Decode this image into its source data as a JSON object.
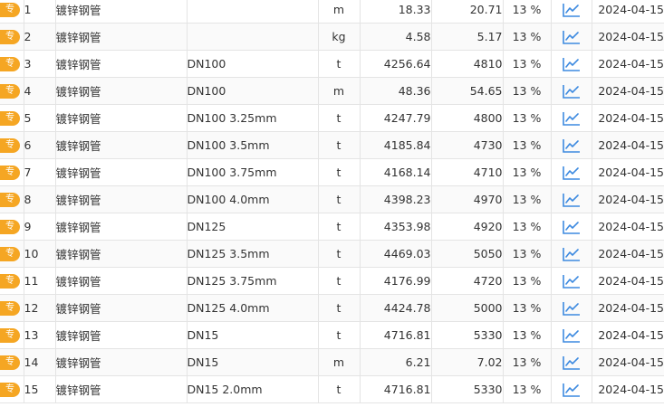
{
  "colors": {
    "badge": "#f5a623",
    "trend_icon": "#3d8ae0",
    "border": "#e4e4e4"
  },
  "row_badge_icon": "special-tag-icon",
  "trend_icon_name": "line-chart-icon",
  "rows": [
    {
      "badge": "专",
      "index": "1",
      "name": "镀锌钢管",
      "spec": "",
      "unit": "m",
      "price": "18.33",
      "price_with_tax": "20.71",
      "tax_rate": "13 %",
      "date": "2024-04-15"
    },
    {
      "badge": "专",
      "index": "2",
      "name": "镀锌钢管",
      "spec": "",
      "unit": "kg",
      "price": "4.58",
      "price_with_tax": "5.17",
      "tax_rate": "13 %",
      "date": "2024-04-15"
    },
    {
      "badge": "专",
      "index": "3",
      "name": "镀锌钢管",
      "spec": "DN100",
      "unit": "t",
      "price": "4256.64",
      "price_with_tax": "4810",
      "tax_rate": "13 %",
      "date": "2024-04-15"
    },
    {
      "badge": "专",
      "index": "4",
      "name": "镀锌钢管",
      "spec": "DN100",
      "unit": "m",
      "price": "48.36",
      "price_with_tax": "54.65",
      "tax_rate": "13 %",
      "date": "2024-04-15"
    },
    {
      "badge": "专",
      "index": "5",
      "name": "镀锌钢管",
      "spec": "DN100  3.25mm",
      "unit": "t",
      "price": "4247.79",
      "price_with_tax": "4800",
      "tax_rate": "13 %",
      "date": "2024-04-15"
    },
    {
      "badge": "专",
      "index": "6",
      "name": "镀锌钢管",
      "spec": "DN100  3.5mm",
      "unit": "t",
      "price": "4185.84",
      "price_with_tax": "4730",
      "tax_rate": "13 %",
      "date": "2024-04-15"
    },
    {
      "badge": "专",
      "index": "7",
      "name": "镀锌钢管",
      "spec": "DN100  3.75mm",
      "unit": "t",
      "price": "4168.14",
      "price_with_tax": "4710",
      "tax_rate": "13 %",
      "date": "2024-04-15"
    },
    {
      "badge": "专",
      "index": "8",
      "name": "镀锌钢管",
      "spec": "DN100  4.0mm",
      "unit": "t",
      "price": "4398.23",
      "price_with_tax": "4970",
      "tax_rate": "13 %",
      "date": "2024-04-15"
    },
    {
      "badge": "专",
      "index": "9",
      "name": "镀锌钢管",
      "spec": "DN125",
      "unit": "t",
      "price": "4353.98",
      "price_with_tax": "4920",
      "tax_rate": "13 %",
      "date": "2024-04-15"
    },
    {
      "badge": "专",
      "index": "10",
      "name": "镀锌钢管",
      "spec": "DN125  3.5mm",
      "unit": "t",
      "price": "4469.03",
      "price_with_tax": "5050",
      "tax_rate": "13 %",
      "date": "2024-04-15"
    },
    {
      "badge": "专",
      "index": "11",
      "name": "镀锌钢管",
      "spec": "DN125  3.75mm",
      "unit": "t",
      "price": "4176.99",
      "price_with_tax": "4720",
      "tax_rate": "13 %",
      "date": "2024-04-15"
    },
    {
      "badge": "专",
      "index": "12",
      "name": "镀锌钢管",
      "spec": "DN125  4.0mm",
      "unit": "t",
      "price": "4424.78",
      "price_with_tax": "5000",
      "tax_rate": "13 %",
      "date": "2024-04-15"
    },
    {
      "badge": "专",
      "index": "13",
      "name": "镀锌钢管",
      "spec": "DN15",
      "unit": "t",
      "price": "4716.81",
      "price_with_tax": "5330",
      "tax_rate": "13 %",
      "date": "2024-04-15"
    },
    {
      "badge": "专",
      "index": "14",
      "name": "镀锌钢管",
      "spec": "DN15",
      "unit": "m",
      "price": "6.21",
      "price_with_tax": "7.02",
      "tax_rate": "13 %",
      "date": "2024-04-15"
    },
    {
      "badge": "专",
      "index": "15",
      "name": "镀锌钢管",
      "spec": "DN15  2.0mm",
      "unit": "t",
      "price": "4716.81",
      "price_with_tax": "5330",
      "tax_rate": "13 %",
      "date": "2024-04-15"
    }
  ]
}
